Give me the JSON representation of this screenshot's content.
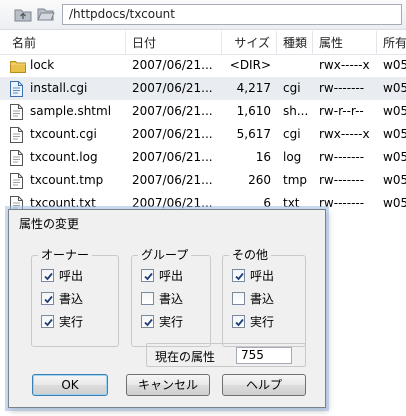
{
  "toolbar": {
    "path": "/httpdocs/txcount",
    "icons": [
      "folder-up-icon",
      "folder-open-icon"
    ]
  },
  "columns": [
    "名前",
    "日付",
    "サイズ",
    "種類",
    "属性",
    "所有"
  ],
  "files": [
    {
      "name": "lock",
      "icon": "folder-icon",
      "date": "2007/06/21...",
      "size": "<DIR>",
      "type": "",
      "attr": "rwx-----x",
      "owner": "w05"
    },
    {
      "name": "install.cgi",
      "icon": "file-icon",
      "date": "2007/06/21...",
      "size": "4,217",
      "type": "cgi",
      "attr": "rw-------",
      "owner": "w05"
    },
    {
      "name": "sample.shtml",
      "icon": "file-icon",
      "date": "2007/06/21...",
      "size": "1,610",
      "type": "sh...",
      "attr": "rw-r--r--",
      "owner": "w05"
    },
    {
      "name": "txcount.cgi",
      "icon": "file-icon",
      "date": "2007/06/21...",
      "size": "5,617",
      "type": "cgi",
      "attr": "rwx-----x",
      "owner": "w05"
    },
    {
      "name": "txcount.log",
      "icon": "file-icon",
      "date": "2007/06/21...",
      "size": "16",
      "type": "log",
      "attr": "rw-------",
      "owner": "w05"
    },
    {
      "name": "txcount.tmp",
      "icon": "file-icon",
      "date": "2007/06/21...",
      "size": "260",
      "type": "tmp",
      "attr": "rw-------",
      "owner": "w05"
    },
    {
      "name": "txcount.txt",
      "icon": "file-icon",
      "date": "2007/06/21...",
      "size": "6",
      "type": "txt",
      "attr": "rw-------",
      "owner": "w05"
    }
  ],
  "dialog": {
    "title": "属性の変更",
    "groups": [
      {
        "title": "オーナー",
        "items": [
          {
            "label": "呼出",
            "checked": true
          },
          {
            "label": "書込",
            "checked": true
          },
          {
            "label": "実行",
            "checked": true
          }
        ]
      },
      {
        "title": "グループ",
        "items": [
          {
            "label": "呼出",
            "checked": true
          },
          {
            "label": "書込",
            "checked": false
          },
          {
            "label": "実行",
            "checked": true
          }
        ]
      },
      {
        "title": "その他",
        "items": [
          {
            "label": "呼出",
            "checked": true
          },
          {
            "label": "書込",
            "checked": false
          },
          {
            "label": "実行",
            "checked": true
          }
        ]
      }
    ],
    "current_label": "現在の属性",
    "current_value": "755",
    "buttons": {
      "ok": "OK",
      "cancel": "キャンセル",
      "help": "ヘルプ"
    }
  },
  "colors": {
    "selected_row": "#e9edf2",
    "folder": "#e8c14a",
    "accent": "#3c7fb1"
  }
}
